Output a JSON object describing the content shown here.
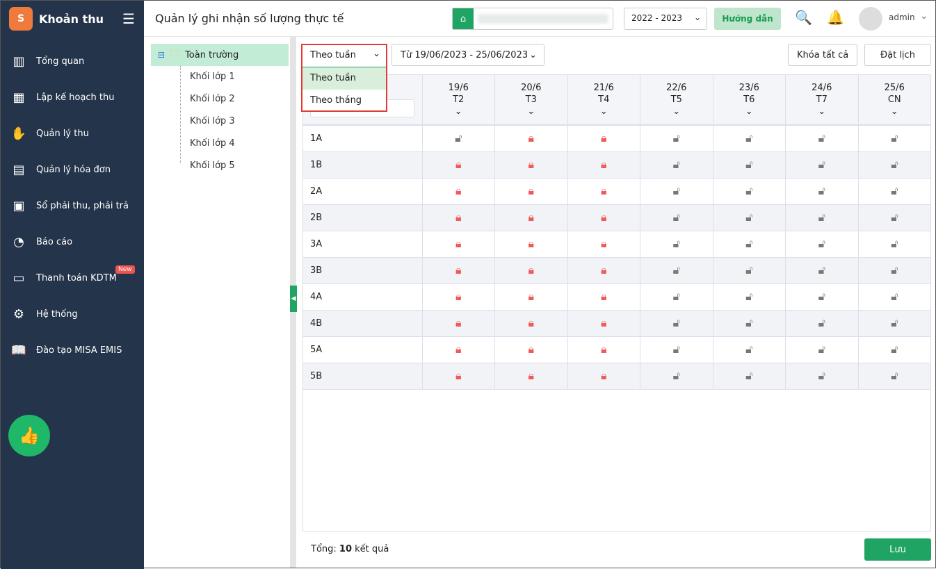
{
  "sidebar": {
    "app_name": "Khoản thu",
    "items": [
      {
        "label": "Tổng quan",
        "icon": "chart-bars-icon",
        "glyph": "▥"
      },
      {
        "label": "Lập kế hoạch thu",
        "icon": "calendar-money-icon",
        "glyph": "▦"
      },
      {
        "label": "Quản lý thu",
        "icon": "hand-coin-icon",
        "glyph": "✋"
      },
      {
        "label": "Quản lý hóa đơn",
        "icon": "invoice-icon",
        "glyph": "▤"
      },
      {
        "label": "Sổ phải thu, phải trả",
        "icon": "ledger-icon",
        "glyph": "▣"
      },
      {
        "label": "Báo cáo",
        "icon": "pie-chart-icon",
        "glyph": "◔"
      },
      {
        "label": "Thanh toán KDTM",
        "icon": "card-icon",
        "glyph": "▭",
        "badge": "New"
      },
      {
        "label": "Hệ thống",
        "icon": "gear-icon",
        "glyph": "⚙"
      },
      {
        "label": "Đào tạo MISA EMIS",
        "icon": "book-icon",
        "glyph": "📖"
      }
    ]
  },
  "header": {
    "title": "Quản lý ghi nhận số lượng thực tế",
    "year": "2022 - 2023",
    "guide": "Hướng dẫn",
    "user": "admin"
  },
  "tree": {
    "root": "Toàn trường",
    "children": [
      "Khối lớp 1",
      "Khối lớp 2",
      "Khối lớp 3",
      "Khối lớp 4",
      "Khối lớp 5"
    ]
  },
  "toolbar": {
    "period": "Theo tuần",
    "period_options": [
      "Theo tuần",
      "Theo tháng"
    ],
    "range": "Từ 19/06/2023 - 25/06/2023",
    "lock_all": "Khóa tất cả",
    "schedule": "Đặt lịch"
  },
  "columns": [
    {
      "date": "19/6",
      "day": "T2"
    },
    {
      "date": "20/6",
      "day": "T3"
    },
    {
      "date": "21/6",
      "day": "T4"
    },
    {
      "date": "22/6",
      "day": "T5"
    },
    {
      "date": "23/6",
      "day": "T6"
    },
    {
      "date": "24/6",
      "day": "T7"
    },
    {
      "date": "25/6",
      "day": "CN"
    }
  ],
  "rows": [
    {
      "class": "1A",
      "locks": [
        false,
        true,
        true,
        false,
        false,
        false,
        false
      ]
    },
    {
      "class": "1B",
      "locks": [
        true,
        true,
        true,
        false,
        false,
        false,
        false
      ]
    },
    {
      "class": "2A",
      "locks": [
        true,
        true,
        true,
        false,
        false,
        false,
        false
      ]
    },
    {
      "class": "2B",
      "locks": [
        true,
        true,
        true,
        false,
        false,
        false,
        false
      ]
    },
    {
      "class": "3A",
      "locks": [
        true,
        true,
        true,
        false,
        false,
        false,
        false
      ]
    },
    {
      "class": "3B",
      "locks": [
        true,
        true,
        true,
        false,
        false,
        false,
        false
      ]
    },
    {
      "class": "4A",
      "locks": [
        true,
        true,
        true,
        false,
        false,
        false,
        false
      ]
    },
    {
      "class": "4B",
      "locks": [
        true,
        true,
        true,
        false,
        false,
        false,
        false
      ]
    },
    {
      "class": "5A",
      "locks": [
        true,
        true,
        true,
        false,
        false,
        false,
        false
      ]
    },
    {
      "class": "5B",
      "locks": [
        true,
        true,
        true,
        false,
        false,
        false,
        false
      ]
    }
  ],
  "footer": {
    "prefix": "Tổng: ",
    "count": "10",
    "suffix": " kết quả",
    "save": "Lưu"
  },
  "colors": {
    "sidebar": "#24344a",
    "accent": "#1fa463",
    "locked": "#ef5a5a"
  }
}
